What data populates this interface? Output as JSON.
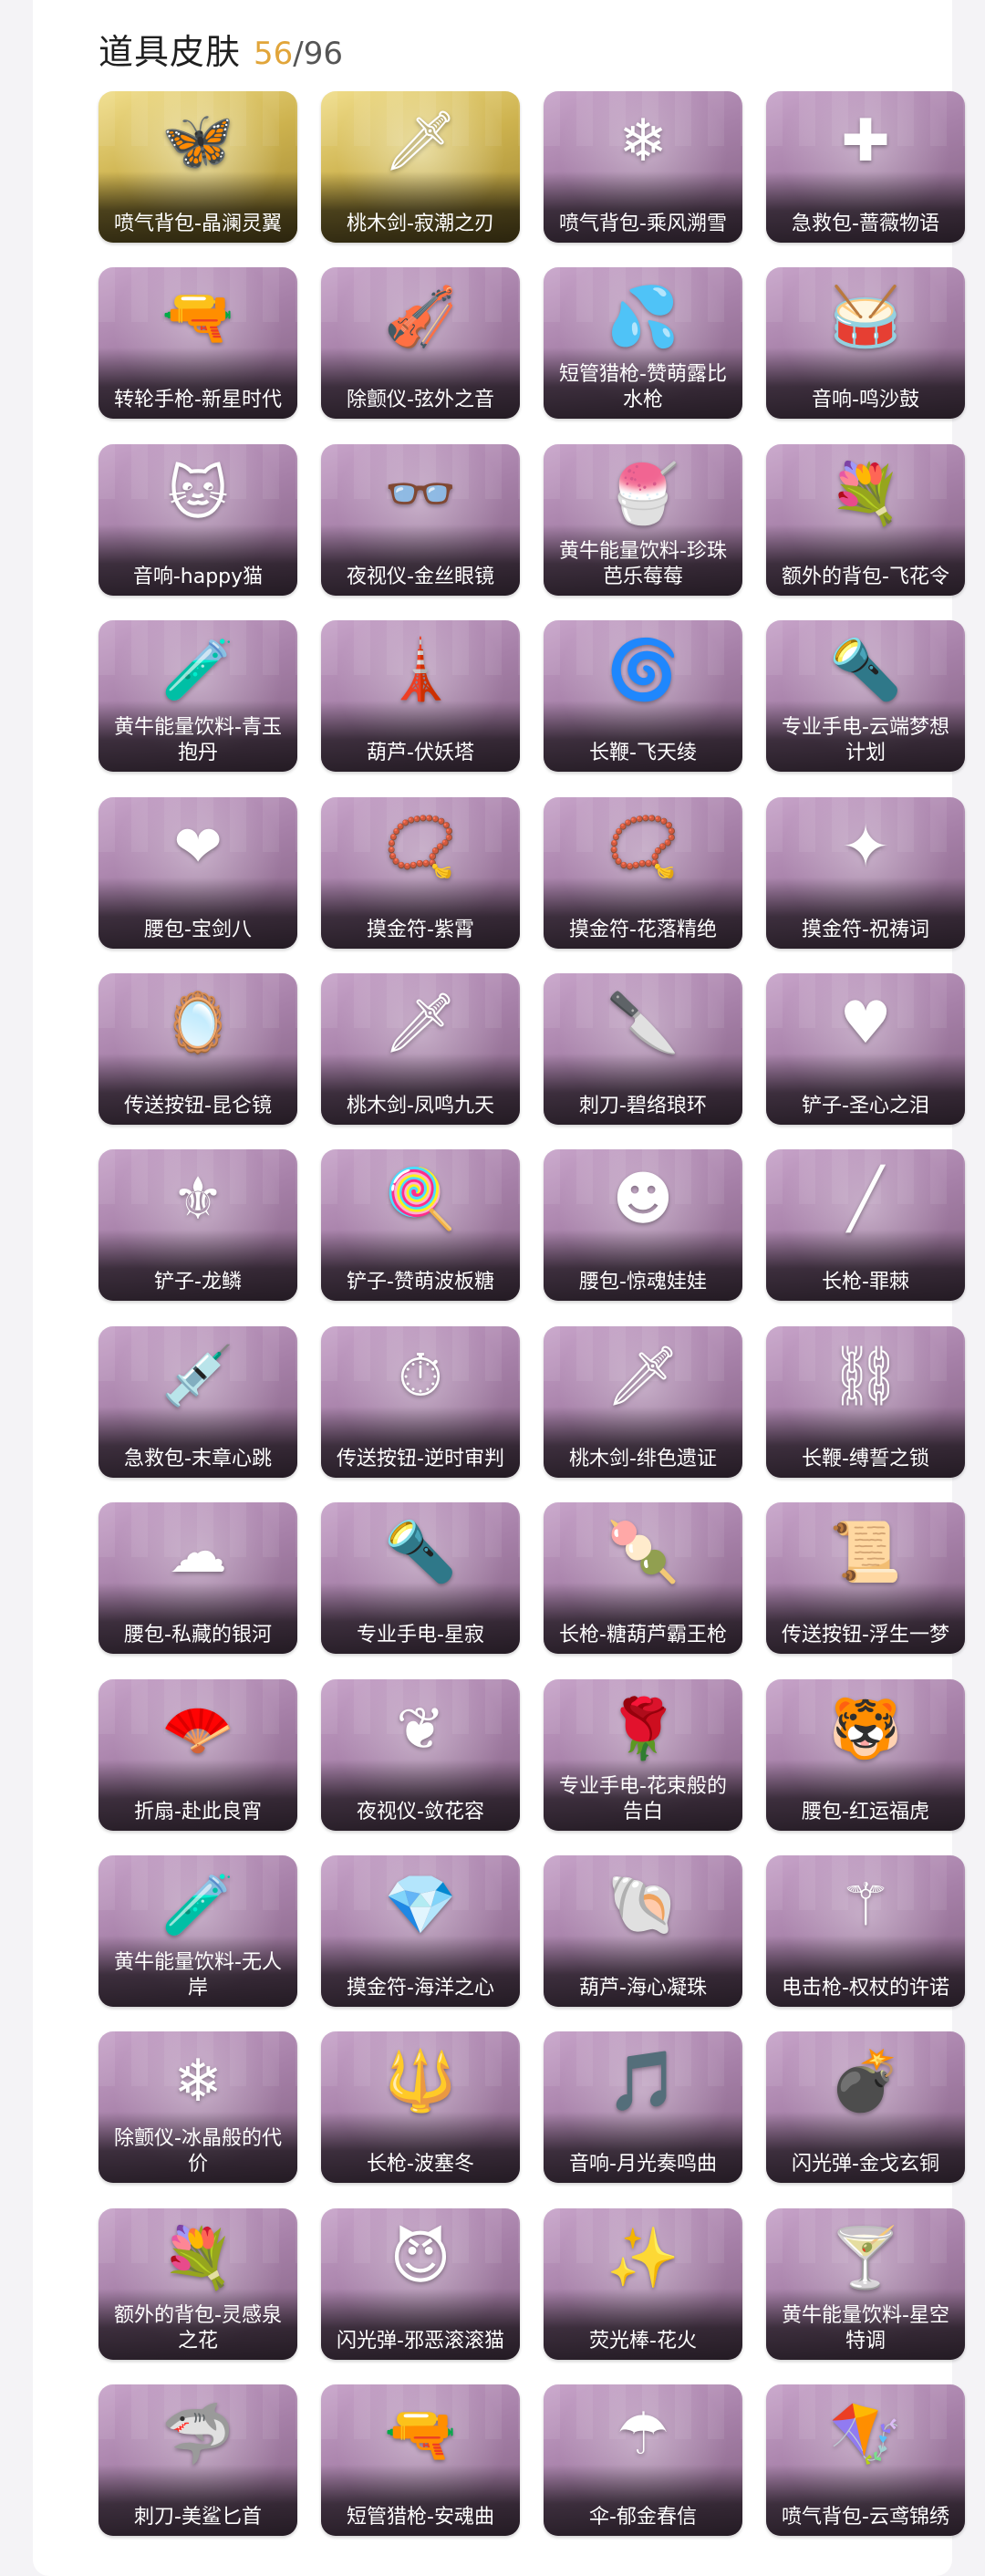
{
  "header": {
    "title": "道具皮肤",
    "owned": "56",
    "separator": "/",
    "total": "96"
  },
  "items": [
    {
      "label": "喷气背包-晶澜灵翼",
      "icon": "jetpack-icon",
      "glyph": "🦋",
      "rarity": "gold"
    },
    {
      "label": "桃木剑-寂潮之刃",
      "icon": "sword-icon",
      "glyph": "🗡",
      "rarity": "gold"
    },
    {
      "label": "喷气背包-乘风溯雪",
      "icon": "jetpack-icon",
      "glyph": "❄",
      "rarity": "purple"
    },
    {
      "label": "急救包-蔷薇物语",
      "icon": "medkit-icon",
      "glyph": "✚",
      "rarity": "purple"
    },
    {
      "label": "转轮手枪-新星时代",
      "icon": "revolver-icon",
      "glyph": "🔫",
      "rarity": "purple"
    },
    {
      "label": "除颤仪-弦外之音",
      "icon": "defibrillator-icon",
      "glyph": "🎻",
      "rarity": "purple"
    },
    {
      "label": "短管猎枪-赞萌露比水枪",
      "icon": "shotgun-icon",
      "glyph": "💦",
      "rarity": "purple"
    },
    {
      "label": "音响-鸣沙鼓",
      "icon": "drum-icon",
      "glyph": "🥁",
      "rarity": "purple"
    },
    {
      "label": "音响-happy猫",
      "icon": "cat-icon",
      "glyph": "🐱",
      "rarity": "purple"
    },
    {
      "label": "夜视仪-金丝眼镜",
      "icon": "glasses-icon",
      "glyph": "👓",
      "rarity": "purple"
    },
    {
      "label": "黄牛能量饮料-珍珠芭乐莓莓",
      "icon": "drink-icon",
      "glyph": "🍧",
      "rarity": "purple"
    },
    {
      "label": "额外的背包-飞花令",
      "icon": "backpack-icon",
      "glyph": "💐",
      "rarity": "purple"
    },
    {
      "label": "黄牛能量饮料-青玉抱丹",
      "icon": "bottle-icon",
      "glyph": "🧪",
      "rarity": "purple"
    },
    {
      "label": "葫芦-伏妖塔",
      "icon": "pagoda-icon",
      "glyph": "🗼",
      "rarity": "purple"
    },
    {
      "label": "长鞭-飞天绫",
      "icon": "whip-icon",
      "glyph": "🌀",
      "rarity": "purple"
    },
    {
      "label": "专业手电-云端梦想计划",
      "icon": "flashlight-icon",
      "glyph": "🔦",
      "rarity": "purple"
    },
    {
      "label": "腰包-宝剑八",
      "icon": "heart-icon",
      "glyph": "❤",
      "rarity": "purple"
    },
    {
      "label": "摸金符-紫霄",
      "icon": "amulet-icon",
      "glyph": "📿",
      "rarity": "purple"
    },
    {
      "label": "摸金符-花落精绝",
      "icon": "amulet-icon",
      "glyph": "📿",
      "rarity": "purple"
    },
    {
      "label": "摸金符-祝祷词",
      "icon": "amulet-icon",
      "glyph": "✦",
      "rarity": "purple"
    },
    {
      "label": "传送按钮-昆仑镜",
      "icon": "mirror-icon",
      "glyph": "🪞",
      "rarity": "purple"
    },
    {
      "label": "桃木剑-凤鸣九天",
      "icon": "sword-icon",
      "glyph": "🗡",
      "rarity": "purple"
    },
    {
      "label": "刺刀-碧络琅环",
      "icon": "blade-icon",
      "glyph": "🔪",
      "rarity": "purple"
    },
    {
      "label": "铲子-圣心之泪",
      "icon": "shovel-icon",
      "glyph": "♥",
      "rarity": "purple"
    },
    {
      "label": "铲子-龙鳞",
      "icon": "shovel-icon",
      "glyph": "⚜",
      "rarity": "purple"
    },
    {
      "label": "铲子-赞萌波板糖",
      "icon": "lollipop-icon",
      "glyph": "🍭",
      "rarity": "purple"
    },
    {
      "label": "腰包-惊魂娃娃",
      "icon": "doll-icon",
      "glyph": "☻",
      "rarity": "purple"
    },
    {
      "label": "长枪-罪棘",
      "icon": "spear-icon",
      "glyph": "╱",
      "rarity": "purple"
    },
    {
      "label": "急救包-末章心跳",
      "icon": "syringe-icon",
      "glyph": "💉",
      "rarity": "purple"
    },
    {
      "label": "传送按钮-逆时审判",
      "icon": "pocketwatch-icon",
      "glyph": "⏱",
      "rarity": "purple"
    },
    {
      "label": "桃木剑-绯色遗证",
      "icon": "sword-icon",
      "glyph": "🗡",
      "rarity": "purple"
    },
    {
      "label": "长鞭-缚誓之锁",
      "icon": "chain-icon",
      "glyph": "⛓",
      "rarity": "purple"
    },
    {
      "label": "腰包-私藏的银河",
      "icon": "cloud-icon",
      "glyph": "☁",
      "rarity": "purple"
    },
    {
      "label": "专业手电-星寂",
      "icon": "flashlight-icon",
      "glyph": "🔦",
      "rarity": "purple"
    },
    {
      "label": "长枪-糖葫芦霸王枪",
      "icon": "candied-haw-icon",
      "glyph": "🍡",
      "rarity": "purple"
    },
    {
      "label": "传送按钮-浮生一梦",
      "icon": "scroll-icon",
      "glyph": "📜",
      "rarity": "purple"
    },
    {
      "label": "折扇-赴此良宵",
      "icon": "fan-icon",
      "glyph": "🪭",
      "rarity": "purple"
    },
    {
      "label": "夜视仪-敛花容",
      "icon": "branch-icon",
      "glyph": "❦",
      "rarity": "purple"
    },
    {
      "label": "专业手电-花束般的告白",
      "icon": "rose-icon",
      "glyph": "🌹",
      "rarity": "purple"
    },
    {
      "label": "腰包-红运福虎",
      "icon": "tiger-icon",
      "glyph": "🐯",
      "rarity": "purple"
    },
    {
      "label": "黄牛能量饮料-无人岸",
      "icon": "bottle-icon",
      "glyph": "🧪",
      "rarity": "purple"
    },
    {
      "label": "摸金符-海洋之心",
      "icon": "amulet-icon",
      "glyph": "💎",
      "rarity": "purple"
    },
    {
      "label": "葫芦-海心凝珠",
      "icon": "shell-icon",
      "glyph": "🐚",
      "rarity": "purple"
    },
    {
      "label": "电击枪-权杖的许诺",
      "icon": "scepter-icon",
      "glyph": "⚚",
      "rarity": "purple"
    },
    {
      "label": "除颤仪-冰晶般的代价",
      "icon": "ice-flower-icon",
      "glyph": "❄",
      "rarity": "purple"
    },
    {
      "label": "长枪-波塞冬",
      "icon": "trident-icon",
      "glyph": "🔱",
      "rarity": "purple"
    },
    {
      "label": "音响-月光奏鸣曲",
      "icon": "music-box-icon",
      "glyph": "🎵",
      "rarity": "purple"
    },
    {
      "label": "闪光弹-金戈玄铜",
      "icon": "grenade-icon",
      "glyph": "💣",
      "rarity": "purple"
    },
    {
      "label": "额外的背包-灵感泉之花",
      "icon": "bouquet-icon",
      "glyph": "💐",
      "rarity": "purple"
    },
    {
      "label": "闪光弹-邪恶滚滚猫",
      "icon": "evil-cat-icon",
      "glyph": "😈",
      "rarity": "purple"
    },
    {
      "label": "荧光棒-花火",
      "icon": "sparkler-icon",
      "glyph": "✨",
      "rarity": "purple"
    },
    {
      "label": "黄牛能量饮料-星空特调",
      "icon": "cocktail-icon",
      "glyph": "🍸",
      "rarity": "purple"
    },
    {
      "label": "刺刀-美鲨匕首",
      "icon": "shark-dagger-icon",
      "glyph": "🦈",
      "rarity": "purple"
    },
    {
      "label": "短管猎枪-安魂曲",
      "icon": "shotgun-icon",
      "glyph": "🔫",
      "rarity": "purple"
    },
    {
      "label": "伞-郁金春信",
      "icon": "umbrella-icon",
      "glyph": "☂",
      "rarity": "purple"
    },
    {
      "label": "喷气背包-云鸢锦绣",
      "icon": "kite-icon",
      "glyph": "🪁",
      "rarity": "purple"
    }
  ]
}
